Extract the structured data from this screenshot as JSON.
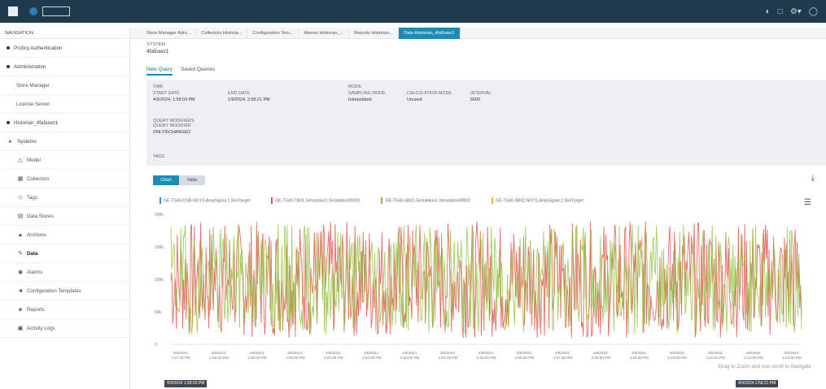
{
  "nav": {
    "title": "NAVIGATION",
    "items": [
      {
        "label": "Proficy Authentication",
        "type": "group"
      },
      {
        "label": "Administration",
        "type": "group"
      },
      {
        "label": "Store Manager",
        "type": "sub"
      },
      {
        "label": "License Server",
        "type": "sub"
      },
      {
        "label": "Historian_4fa5uwz1",
        "type": "group"
      },
      {
        "label": "Systems",
        "type": "folder"
      },
      {
        "label": "Model",
        "type": "sub"
      },
      {
        "label": "Collectors",
        "type": "sub"
      },
      {
        "label": "Tags",
        "type": "sub"
      },
      {
        "label": "Data Stores",
        "type": "sub"
      },
      {
        "label": "Archives",
        "type": "sub"
      },
      {
        "label": "Data",
        "type": "sub",
        "active": true
      },
      {
        "label": "Alarms",
        "type": "sub"
      },
      {
        "label": "Configuration Templates",
        "type": "sub"
      },
      {
        "label": "Reports",
        "type": "sub"
      },
      {
        "label": "Activity Logs",
        "type": "sub"
      }
    ]
  },
  "tabs": [
    "Store Manager Adm...",
    "Collectors Historia...",
    "Configuration Tem...",
    "Alarms Historian_...",
    "Reports Historian...",
    "Data Historian_4fa5uwz1"
  ],
  "header": {
    "label": "SYSTEM",
    "value": "4fa5uwz1"
  },
  "query_tabs": [
    "New Query",
    "Saved Queries"
  ],
  "filters": {
    "time_label": "TIME",
    "start_label": "START DATE",
    "start_value": "4/9/2024, 1:58:03 PM",
    "end_label": "END DATE",
    "end_value": "1/9/2024, 2:58:21 PM",
    "mode_label": "MODE",
    "sampling_label": "SAMPLING MODE",
    "sampling_value": "Interpolated",
    "calc_label": "CALCULATION MODE",
    "calc_value": "Unused",
    "interval_label": "INTERVAL",
    "interval_value": "5000",
    "qmod_label": "QUERY MODIFIERS",
    "qmod_label2": "QUERY MODIFIER",
    "qmod_value": "ONLYIFCHANGED",
    "tags_label": "TAGS"
  },
  "view_buttons": [
    "Chart",
    "Table"
  ],
  "legend": [
    {
      "name": "GE-TS40-OSB-NOTS.AmpSignal.1.SimTarget",
      "color": "#3a8fd0"
    },
    {
      "name": "GE-TS40-TB01.Simulation1.Simulation00001",
      "color": "#e65050"
    },
    {
      "name": "GE-TS40-SB01.Simulation1.Simulation00002",
      "color": "#8fbf3a"
    },
    {
      "name": "GE-TS40-SB02.NOTS.AmpSignal.1.SimTarget",
      "color": "#e8b830"
    }
  ],
  "chart_data": {
    "type": "line",
    "y_ticks": [
      "200k",
      "150k",
      "100k",
      "50k",
      "0"
    ],
    "ylim": [
      0,
      200000
    ],
    "x_ticks": [
      "4/9/2024, 1:57:00 PM",
      "4/9/2024, 1:58:00 PM",
      "4/9/2024, 1:59:00 PM",
      "4/9/2024, 2:00:00 PM",
      "4/9/2024, 2:01:00 PM",
      "4/9/2024, 2:02:00 PM",
      "4/9/2024, 2:03:00 PM",
      "4/9/2024, 2:04:00 PM",
      "4/9/2024, 2:05:00 PM",
      "4/9/2024, 2:06:00 PM",
      "4/9/2024, 2:07:00 PM",
      "4/9/2024, 2:08:00 PM",
      "4/9/2024, 2:09:00 PM",
      "4/9/2024, 2:10:00 PM",
      "4/9/2024, 2:11:00 PM",
      "4/9/2024, 2:12:00 PM",
      "4/9/2024, 2:13:00 PM"
    ],
    "series": [
      {
        "name": "GE-TS40-TB01.Simulation1.Simulation00001",
        "color": "#e65050",
        "mean": 100000,
        "amp": 90000,
        "seed": 7
      },
      {
        "name": "GE-TS40-SB01.Simulation1.Simulation00002",
        "color": "#8fbf3a",
        "mean": 100000,
        "amp": 85000,
        "seed": 19
      }
    ],
    "grid": false
  },
  "caption": "Drag to Zoom and use scroll to Navigate",
  "range_start": "4/9/2024 1:58:03 PM",
  "range_end": "4/9/2024 2:58:21 PM"
}
